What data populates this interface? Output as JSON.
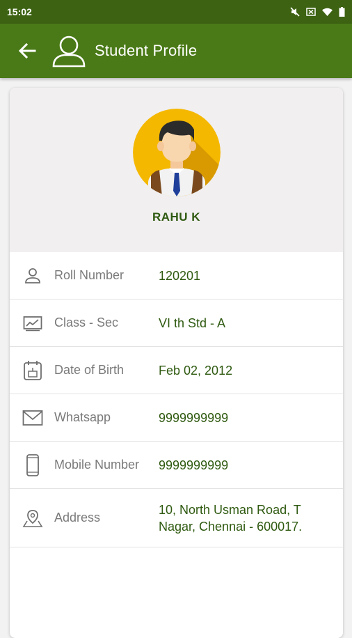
{
  "status_bar": {
    "time": "15:02",
    "icons": [
      "mute-icon",
      "close-box-icon",
      "wifi-icon",
      "battery-icon"
    ]
  },
  "app_bar": {
    "title": "Student Profile",
    "back_icon": "arrow-left-icon",
    "profile_icon": "user-outline-icon",
    "color": "#4a7a17"
  },
  "student": {
    "name": "RAHU K",
    "avatar_icon": "student-avatar"
  },
  "details": [
    {
      "icon": "person-icon",
      "label": "Roll Number",
      "value": "120201"
    },
    {
      "icon": "chart-icon",
      "label": "Class - Sec",
      "value": "VI th Std - A"
    },
    {
      "icon": "cake-calendar-icon",
      "label": "Date of Birth",
      "value": "Feb 02, 2012"
    },
    {
      "icon": "mail-icon",
      "label": "Whatsapp",
      "value": "9999999999"
    },
    {
      "icon": "mobile-icon",
      "label": "Mobile Number",
      "value": "9999999999"
    },
    {
      "icon": "location-pin-icon",
      "label": "Address",
      "value_line1": "10, North Usman Road, T",
      "value_line2": "Nagar, Chennai - 600017."
    }
  ],
  "colors": {
    "status_bar": "#3d6312",
    "accent_text": "#2f5a10",
    "label_text": "#7a7a7a"
  }
}
